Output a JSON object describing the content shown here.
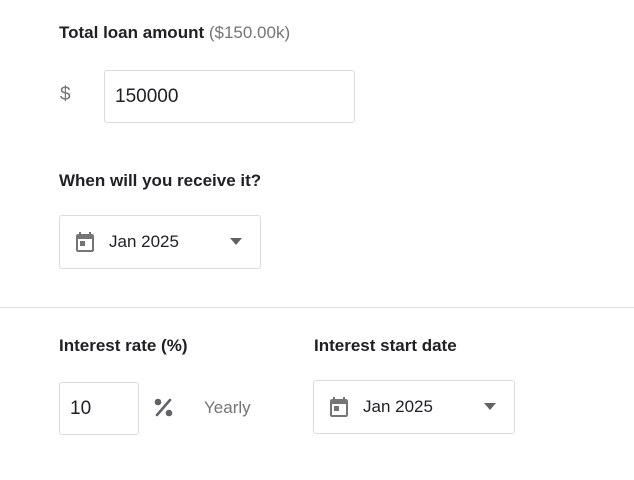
{
  "loan": {
    "label": "Total loan amount",
    "hint": "($150.00k)",
    "currency_symbol": "$",
    "amount_value": "150000"
  },
  "receive": {
    "label": "When will you receive it?",
    "date_value": "Jan 2025",
    "icon": "calendar-icon"
  },
  "interest": {
    "rate_label": "Interest rate (%)",
    "rate_value": "10",
    "percent_icon": "percent-icon",
    "period": "Yearly",
    "start_label": "Interest start date",
    "start_value": "Jan 2025"
  },
  "colors": {
    "text": "#202124",
    "muted": "#757575",
    "border": "#dadce0",
    "icon": "#757575"
  }
}
